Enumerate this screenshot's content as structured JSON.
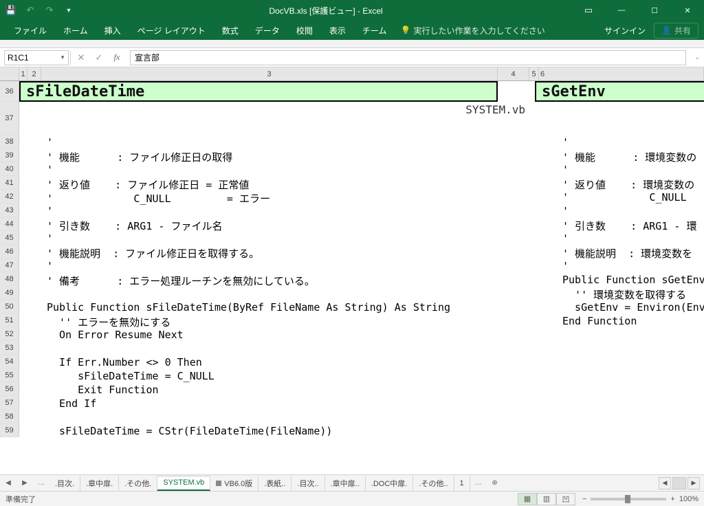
{
  "title": "DocVB.xls [保護ビュー] - Excel",
  "ribbon": {
    "file": "ファイル",
    "home": "ホーム",
    "insert": "挿入",
    "layout": "ページ レイアウト",
    "formula": "数式",
    "data": "データ",
    "review": "校閲",
    "view": "表示",
    "team": "チーム",
    "tellme": "実行したい作業を入力してください",
    "signin": "サインイン",
    "share": "共有"
  },
  "namebox": "R1C1",
  "formula": "宣言部",
  "cols": {
    "c1": "1",
    "c2": "2",
    "c3": "3",
    "c4": "4",
    "c5": "5",
    "c6": "6"
  },
  "rows": {
    "r36": "36",
    "r37": "37",
    "r38": "38",
    "r39": "39",
    "r40": "40",
    "r41": "41",
    "r42": "42",
    "r43": "43",
    "r44": "44",
    "r45": "45",
    "r46": "46",
    "r47": "47",
    "r48": "48",
    "r49": "49",
    "r50": "50",
    "r51": "51",
    "r52": "52",
    "r53": "53",
    "r54": "54",
    "r55": "55",
    "r56": "56",
    "r57": "57",
    "r58": "58",
    "r59": "59"
  },
  "h1": "sFileDateTime",
  "h2": "sGetEnv",
  "sysvb": "SYSTEM.vb",
  "code1": {
    "l38": "'",
    "l39": "' 機能      : ファイル修正日の取得",
    "l40": "'",
    "l41": "' 返り値    : ファイル修正日 = 正常値",
    "l42": "'             C_NULL         = エラー",
    "l43": "'",
    "l44": "' 引き数    : ARG1 - ファイル名",
    "l45": "'",
    "l46": "' 機能説明  : ファイル修正日を取得する。",
    "l47": "'",
    "l48": "' 備考      : エラー処理ルーチンを無効にしている。",
    "l49": "",
    "l50": "Public Function sFileDateTime(ByRef FileName As String) As String",
    "l51": "  '' エラーを無効にする",
    "l52": "  On Error Resume Next",
    "l53": "",
    "l54": "  If Err.Number <> 0 Then",
    "l55": "     sFileDateTime = C_NULL",
    "l56": "     Exit Function",
    "l57": "  End If",
    "l58": "",
    "l59": "  sFileDateTime = CStr(FileDateTime(FileName))"
  },
  "code2": {
    "l38": "'",
    "l39": "' 機能      : 環境変数の",
    "l40": "'",
    "l41": "' 返り値    : 環境変数の",
    "l42": "'             C_NULL",
    "l43": "'",
    "l44": "' 引き数    : ARG1 - 環",
    "l45": "'",
    "l46": "' 機能説明  : 環境変数を",
    "l47": "'",
    "l48": "Public Function sGetEnv",
    "l49": "  '' 環境変数を取得する",
    "l50": "  sGetEnv = Environ(Env)",
    "l51": "End Function"
  },
  "tabs": {
    "nav1": "…",
    "t1": ".目次.",
    "t2": ".章中扉.",
    "t3": ".その他.",
    "t4": "SYSTEM.vb",
    "t5": "VB6.0版",
    "t6": ".表紙..",
    "t7": ".目次..",
    "t8": ".章中扉..",
    "t9": ".DOC中扉.",
    "t10": ".その他..",
    "t11": "1",
    "more": "…",
    "add": "⊕"
  },
  "status": {
    "ready": "準備完了",
    "zoom": "100%"
  }
}
